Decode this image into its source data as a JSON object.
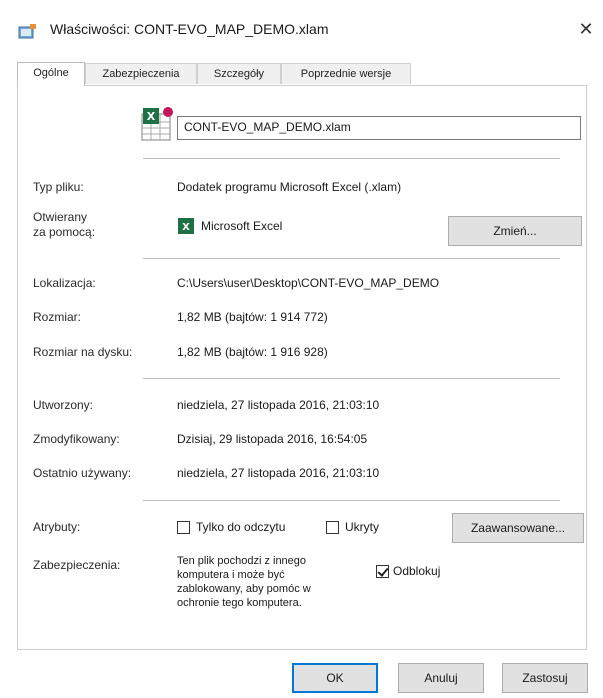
{
  "window": {
    "title": "Właściwości: CONT-EVO_MAP_DEMO.xlam",
    "close_glyph": "✕"
  },
  "tabs": [
    {
      "label": "Ogólne",
      "active": true
    },
    {
      "label": "Zabezpieczenia",
      "active": false
    },
    {
      "label": "Szczegóły",
      "active": false
    },
    {
      "label": "Poprzednie wersje",
      "active": false
    }
  ],
  "general": {
    "file_name": "CONT-EVO_MAP_DEMO.xlam",
    "file_type_label": "Typ pliku:",
    "file_type_value": "Dodatek programu Microsoft Excel (.xlam)",
    "opens_with_label_line1": "Otwierany",
    "opens_with_label_line2": "za pomocą:",
    "opens_with_value": "Microsoft Excel",
    "change_button": "Zmień...",
    "location_label": "Lokalizacja:",
    "location_value": "C:\\Users\\user\\Desktop\\CONT-EVO_MAP_DEMO",
    "size_label": "Rozmiar:",
    "size_value": "1,82 MB (bajtów: 1 914 772)",
    "size_on_disk_label": "Rozmiar na dysku:",
    "size_on_disk_value": "1,82 MB (bajtów: 1 916 928)",
    "created_label": "Utworzony:",
    "created_value": "niedziela, 27 listopada 2016, 21:03:10",
    "modified_label": "Zmodyfikowany:",
    "modified_value": "Dzisiaj, 29 listopada 2016, 16:54:05",
    "accessed_label": "Ostatnio używany:",
    "accessed_value": "niedziela, 27 listopada 2016, 21:03:10",
    "attributes_label": "Atrybuty:",
    "readonly_label": "Tylko do odczytu",
    "readonly_checked": false,
    "hidden_label": "Ukryty",
    "hidden_checked": false,
    "advanced_button": "Zaawansowane...",
    "security_label": "Zabezpieczenia:",
    "security_lines": [
      "Ten plik pochodzi z innego",
      "komputera i może być",
      "zablokowany, aby pomóc w",
      "ochronie tego komputera."
    ],
    "unblock_label": "Odblokuj",
    "unblock_checked": true
  },
  "footer": {
    "ok": "OK",
    "cancel": "Anuluj",
    "apply": "Zastosuj"
  },
  "colors": {
    "excel_green": "#1e7145",
    "accent": "#0078d7"
  }
}
